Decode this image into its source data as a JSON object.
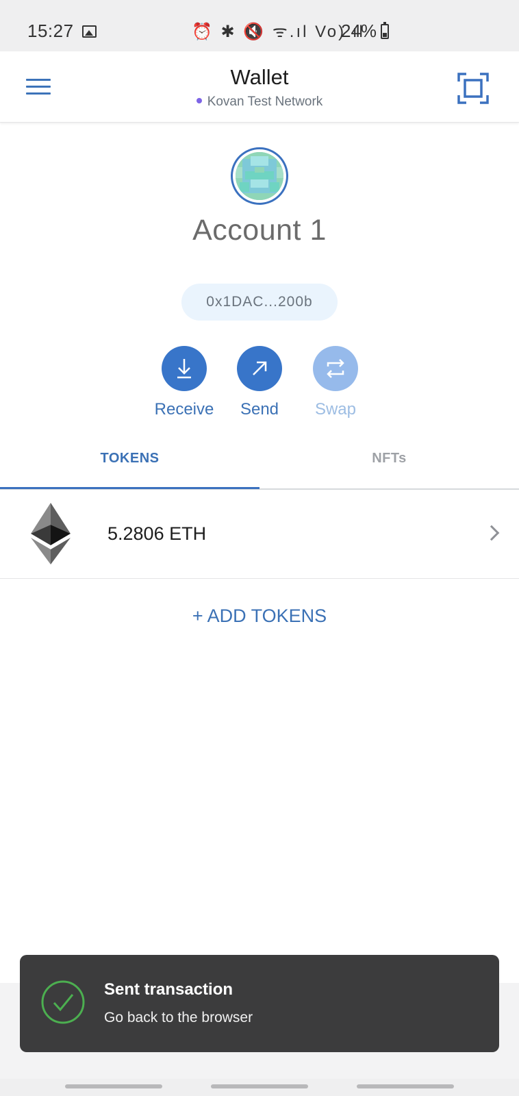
{
  "status_bar": {
    "time": "15:27",
    "icons": "⏰ ✱ 🔇 ᯤ.ıl Vo) ıl",
    "battery": "24%"
  },
  "header": {
    "title": "Wallet",
    "network": "Kovan Test Network",
    "network_dot_color": "#7d64e6"
  },
  "account": {
    "name": "Account 1",
    "address": "0x1DAC...200b"
  },
  "actions": [
    {
      "label": "Receive",
      "icon": "download-icon",
      "enabled": true
    },
    {
      "label": "Send",
      "icon": "arrow-up-right-icon",
      "enabled": true
    },
    {
      "label": "Swap",
      "icon": "swap-icon",
      "enabled": false
    }
  ],
  "tabs": [
    {
      "label": "TOKENS",
      "active": true
    },
    {
      "label": "NFTs",
      "active": false
    }
  ],
  "tokens": [
    {
      "amount": "5.2806 ETH",
      "icon": "ethereum-icon"
    }
  ],
  "add_tokens_label": "+ ADD TOKENS",
  "toast": {
    "title": "Sent transaction",
    "subtitle": "Go back to the browser",
    "icon": "check-circle-icon",
    "accent": "#4caf50"
  },
  "colors": {
    "primary": "#3875c9",
    "primary_text": "#3b71b5",
    "disabled": "#96baeb"
  }
}
